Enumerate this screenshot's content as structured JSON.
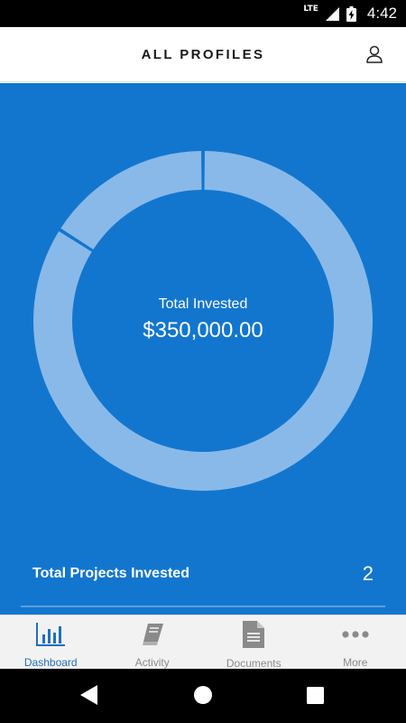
{
  "status_bar": {
    "network": "LTE",
    "time": "4:42"
  },
  "header": {
    "title": "ALL PROFILES"
  },
  "summary": {
    "label": "Total Invested",
    "value": "$350,000.00",
    "projects_label": "Total Projects Invested",
    "projects_count": "2"
  },
  "chart_data": {
    "type": "pie",
    "slices": [
      {
        "value": 0.84
      },
      {
        "value": 0.16
      }
    ]
  },
  "colors": {
    "primary": "#1276cf",
    "donut": "#89b9e8",
    "tab_active": "#1f6fc0",
    "tab_inactive": "#8a8a8a"
  },
  "tabs": [
    {
      "label": "Dashboard",
      "icon": "bar-chart-icon",
      "active": true
    },
    {
      "label": "Activity",
      "icon": "book-icon",
      "active": false
    },
    {
      "label": "Documents",
      "icon": "document-icon",
      "active": false
    },
    {
      "label": "More",
      "icon": "more-dots-icon",
      "active": false
    }
  ]
}
